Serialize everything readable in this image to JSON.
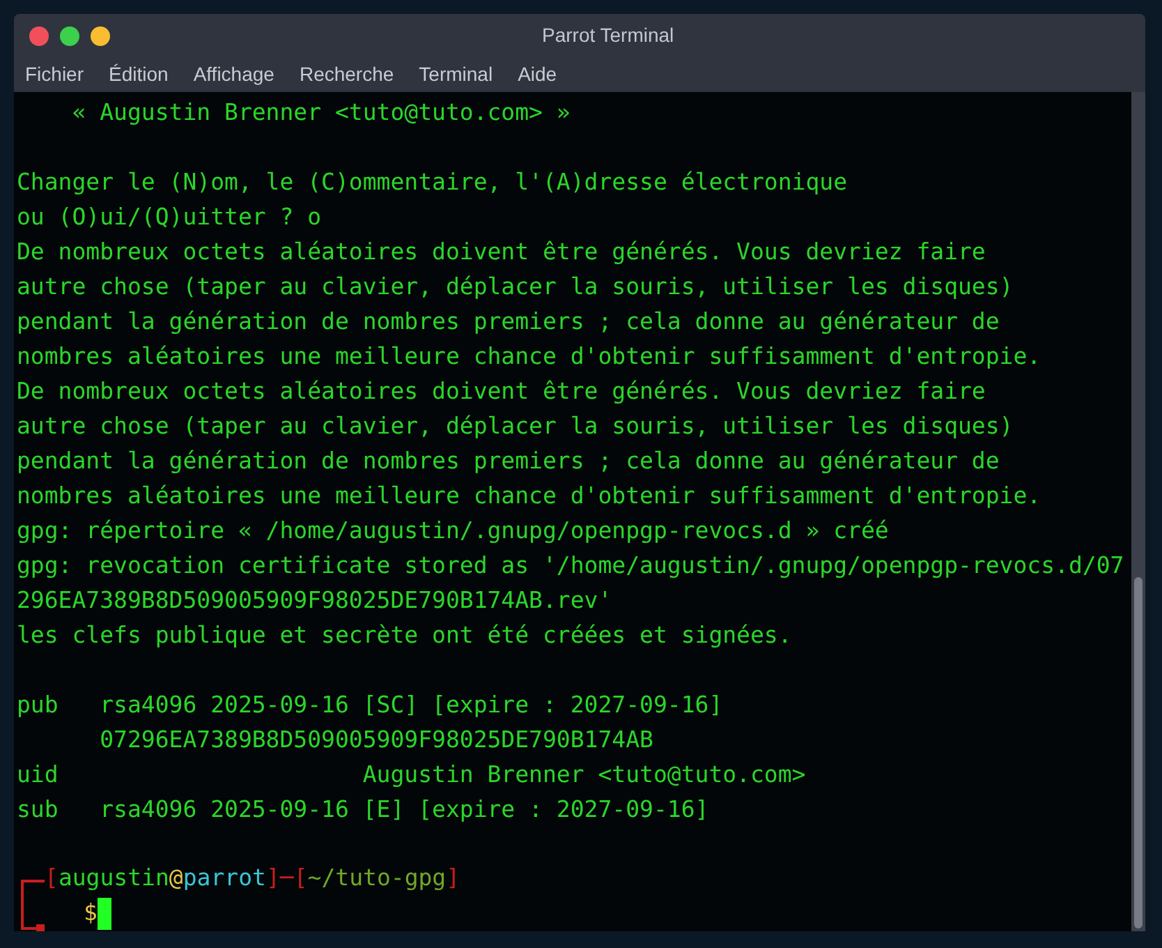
{
  "window": {
    "title": "Parrot Terminal"
  },
  "menu": [
    "Fichier",
    "Édition",
    "Affichage",
    "Recherche",
    "Terminal",
    "Aide"
  ],
  "terminal": {
    "lines": [
      {
        "kind": "text",
        "text": "    « Augustin Brenner <tuto@tuto.com> »"
      },
      {
        "kind": "blank"
      },
      {
        "kind": "text",
        "text": "Changer le (N)om, le (C)ommentaire, l'(A)dresse électronique"
      },
      {
        "kind": "text",
        "text": "ou (O)ui/(Q)uitter ? o"
      },
      {
        "kind": "text",
        "text": "De nombreux octets aléatoires doivent être générés. Vous devriez faire"
      },
      {
        "kind": "text",
        "text": "autre chose (taper au clavier, déplacer la souris, utiliser les disques)"
      },
      {
        "kind": "text",
        "text": "pendant la génération de nombres premiers ; cela donne au générateur de"
      },
      {
        "kind": "text",
        "text": "nombres aléatoires une meilleure chance d'obtenir suffisamment d'entropie."
      },
      {
        "kind": "text",
        "text": "De nombreux octets aléatoires doivent être générés. Vous devriez faire"
      },
      {
        "kind": "text",
        "text": "autre chose (taper au clavier, déplacer la souris, utiliser les disques)"
      },
      {
        "kind": "text",
        "text": "pendant la génération de nombres premiers ; cela donne au générateur de"
      },
      {
        "kind": "text",
        "text": "nombres aléatoires une meilleure chance d'obtenir suffisamment d'entropie."
      },
      {
        "kind": "text",
        "text": "gpg: répertoire « /home/augustin/.gnupg/openpgp-revocs.d » créé"
      },
      {
        "kind": "text",
        "text": "gpg: revocation certificate stored as '/home/augustin/.gnupg/openpgp-revocs.d/07"
      },
      {
        "kind": "text",
        "text": "296EA7389B8D509005909F98025DE790B174AB.rev'"
      },
      {
        "kind": "text",
        "text": "les clefs publique et secrète ont été créées et signées."
      },
      {
        "kind": "blank"
      },
      {
        "kind": "text",
        "text": "pub   rsa4096 2025-09-16 [SC] [expire : 2027-09-16]"
      },
      {
        "kind": "text",
        "text": "      07296EA7389B8D509005909F98025DE790B174AB"
      },
      {
        "kind": "text",
        "text": "uid                      Augustin Brenner <tuto@tuto.com>"
      },
      {
        "kind": "text",
        "text": "sub   rsa4096 2025-09-16 [E] [expire : 2027-09-16]"
      },
      {
        "kind": "blank"
      }
    ],
    "prompt": {
      "segments": [
        {
          "text": "[",
          "color": "#c81e1e"
        },
        {
          "text": "augustin",
          "color": "#2bd62b"
        },
        {
          "text": "@",
          "color": "#e8c54a"
        },
        {
          "text": "parrot",
          "color": "#39c6d6"
        },
        {
          "text": "]",
          "color": "#c81e1e"
        },
        {
          "text": "─",
          "color": "#c81e1e"
        },
        {
          "text": "[",
          "color": "#c81e1e"
        },
        {
          "text": "~/tuto-gpg",
          "color": "#6fa82a"
        },
        {
          "text": "]",
          "color": "#c81e1e"
        }
      ],
      "symbol": "$"
    }
  }
}
